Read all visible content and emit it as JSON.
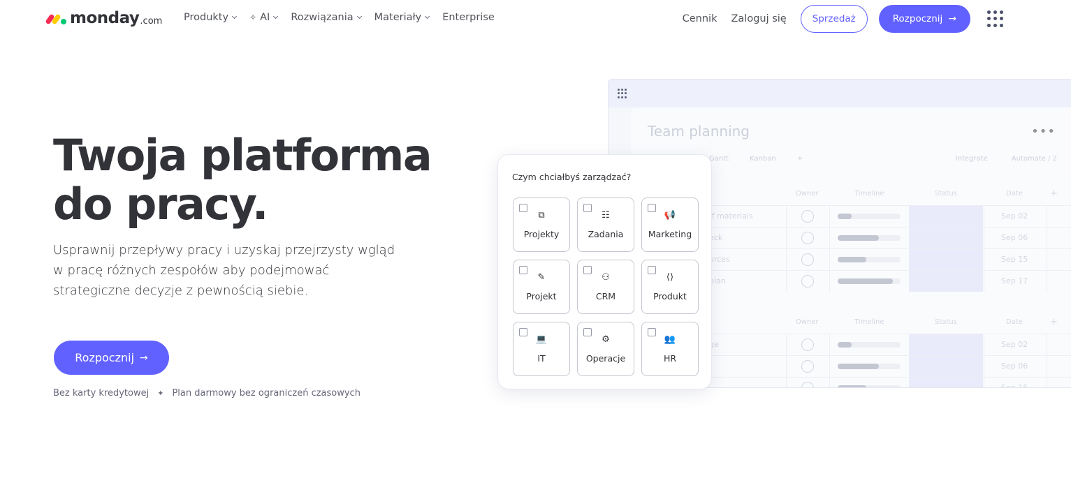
{
  "nav": {
    "logo_text": "monday",
    "logo_suffix": ".com",
    "menu": [
      {
        "label": "Produkty",
        "has_dropdown": true
      },
      {
        "label": "AI",
        "has_dropdown": true,
        "icon": "sparkle-icon"
      },
      {
        "label": "Rozwiązania",
        "has_dropdown": true
      },
      {
        "label": "Materiały",
        "has_dropdown": true
      },
      {
        "label": "Enterprise",
        "has_dropdown": false
      }
    ],
    "pricing": "Cennik",
    "login": "Zaloguj się",
    "sales_button": "Sprzedaż",
    "start_button": "Rozpocznij",
    "start_arrow": "→"
  },
  "hero": {
    "title_line1": "Twoja platforma",
    "title_line2": "do pracy.",
    "subtitle_line1": "Usprawnij przepływy pracy i uzyskaj przejrzysty wgląd",
    "subtitle_line2": "w pracę różnych zespołów aby podejmować",
    "subtitle_line3": "strategiczne decyzje z pewnością siebie.",
    "cta": "Rozpocznij",
    "cta_arrow": "→",
    "note_1": "Bez karty kredytowej",
    "note_sep": "✦",
    "note_2": "Plan darmowy bez ograniczeń czasowych"
  },
  "preview": {
    "board_title": "Team planning",
    "more": "•••",
    "toolbar": {
      "gantt": "Gantt",
      "kanban": "Kanban",
      "add": "+",
      "integrate": "Integrate",
      "automate": "Automate / 2"
    },
    "columns": {
      "owner": "Owner",
      "timeline": "Timeline",
      "status": "Status",
      "date": "Date",
      "add": "+"
    },
    "group1": [
      {
        "name": "ff materials",
        "timeline_fill": 0.22,
        "date": "Sep 02"
      },
      {
        "name": "eck",
        "timeline_fill": 0.65,
        "date": "Sep 06"
      },
      {
        "name": "urces",
        "timeline_fill": 0.45,
        "date": "Sep 15"
      },
      {
        "name": "plan",
        "timeline_fill": 0.88,
        "date": "Sep 17"
      }
    ],
    "group2": [
      {
        "name": "ge",
        "timeline_fill": 0.22,
        "date": "Sep 02"
      },
      {
        "name": "",
        "timeline_fill": 0.65,
        "date": "Sep 06"
      },
      {
        "name": "",
        "timeline_fill": 0.45,
        "date": "Sep 15"
      }
    ]
  },
  "selector": {
    "question": "Czym chciałbyś zarządzać?",
    "options": [
      {
        "label": "Projekty",
        "icon": "projects-icon",
        "glyph": "⧉"
      },
      {
        "label": "Zadania",
        "icon": "tasks-icon",
        "glyph": "☷"
      },
      {
        "label": "Marketing",
        "icon": "megaphone-icon",
        "glyph": "📢"
      },
      {
        "label": "Projekt",
        "icon": "design-icon",
        "glyph": "✎"
      },
      {
        "label": "CRM",
        "icon": "crm-icon",
        "glyph": "⚇"
      },
      {
        "label": "Produkt",
        "icon": "code-icon",
        "glyph": "⟨⟩"
      },
      {
        "label": "IT",
        "icon": "laptop-icon",
        "glyph": "💻"
      },
      {
        "label": "Operacje",
        "icon": "gear-icon",
        "glyph": "⚙"
      },
      {
        "label": "HR",
        "icon": "people-icon",
        "glyph": "👥"
      }
    ]
  },
  "colors": {
    "primary": "#6161ff",
    "text": "#323338",
    "muted": "#676879"
  }
}
